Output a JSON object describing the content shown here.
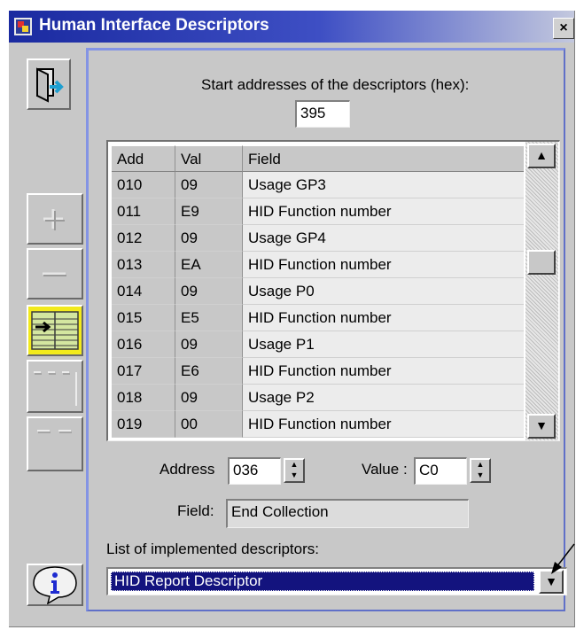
{
  "window": {
    "title": "Human Interface Descriptors",
    "close_glyph": "×"
  },
  "start_address": {
    "label": "Start addresses of the descriptors (hex):",
    "value": "395"
  },
  "table": {
    "columns": [
      "Add",
      "Val",
      "Field"
    ],
    "rows": [
      [
        "010",
        "09",
        "Usage GP3"
      ],
      [
        "011",
        "E9",
        "HID Function number"
      ],
      [
        "012",
        "09",
        "Usage GP4"
      ],
      [
        "013",
        "EA",
        "HID Function number"
      ],
      [
        "014",
        "09",
        "Usage P0"
      ],
      [
        "015",
        "E5",
        "HID Function number"
      ],
      [
        "016",
        "09",
        "Usage P1"
      ],
      [
        "017",
        "E6",
        "HID Function number"
      ],
      [
        "018",
        "09",
        "Usage P2"
      ],
      [
        "019",
        "00",
        "HID Function number"
      ]
    ]
  },
  "editor": {
    "address_label": "Address",
    "address_value": "036",
    "value_label": "Value :",
    "value_value": "C0",
    "field_label": "Field:",
    "field_value": "End Collection"
  },
  "descriptors": {
    "label": "List of implemented descriptors:",
    "selected": "HID Report Descriptor"
  },
  "icons": {
    "exit": "door-exit-icon",
    "add": "plus-icon",
    "remove": "minus-icon",
    "table": "table-arrow-icon",
    "info": "info-speech-bubble-icon"
  },
  "colors": {
    "title_bar": "#1a2aa0",
    "selection": "#13137e",
    "highlight_button": "#f2ea1c"
  }
}
